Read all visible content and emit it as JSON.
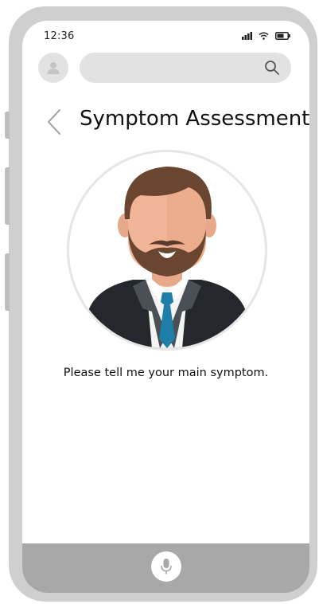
{
  "status_bar": {
    "time": "12:36",
    "icons": [
      "signal-icon",
      "wifi-icon",
      "battery-icon"
    ]
  },
  "top_bar": {
    "avatar_icon": "user-avatar-icon",
    "search": {
      "value": "",
      "icon": "search-icon"
    }
  },
  "header": {
    "back_icon": "chevron-left-icon",
    "title": "Symptom Assessment"
  },
  "main": {
    "illustration": "doctor-avatar",
    "prompt": "Please tell me your main symptom."
  },
  "bottom_bar": {
    "mic_icon": "microphone-icon"
  },
  "colors": {
    "frame": "#cfcfcf",
    "bottom_bar": "#a8a8a8",
    "search_bg": "#e2e2e2",
    "tie": "#1f7ea8"
  }
}
